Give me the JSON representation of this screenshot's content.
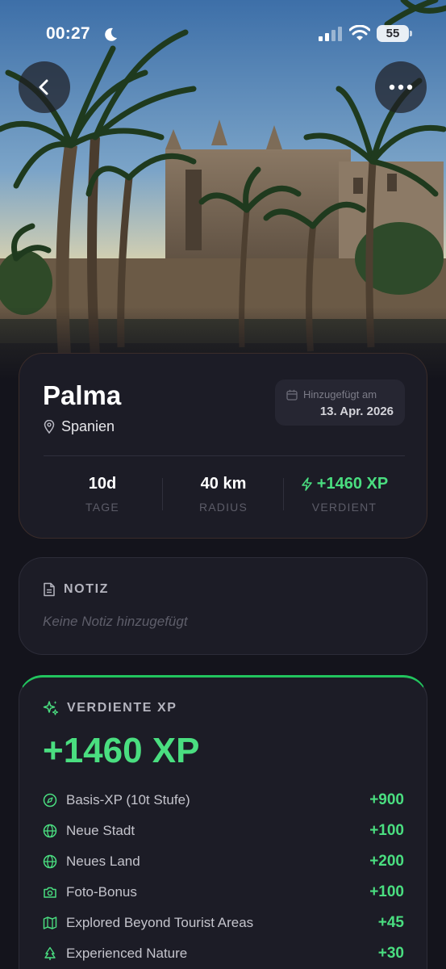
{
  "status_bar": {
    "time": "00:27",
    "battery": "55"
  },
  "place": {
    "city": "Palma",
    "country": "Spanien",
    "added_label": "Hinzugefügt am",
    "added_date": "13. Apr. 2026"
  },
  "stats": [
    {
      "value": "10d",
      "label": "TAGE"
    },
    {
      "value": "40 km",
      "label": "RADIUS"
    },
    {
      "value": "+1460 XP",
      "label": "VERDIENT"
    }
  ],
  "note": {
    "title": "NOTIZ",
    "placeholder": "Keine Notiz hinzugefügt"
  },
  "xp": {
    "title": "VERDIENTE XP",
    "total": "+1460 XP",
    "items": [
      {
        "icon": "compass-icon",
        "label": "Basis-XP (10t Stufe)",
        "value": "+900"
      },
      {
        "icon": "globe-icon",
        "label": "Neue Stadt",
        "value": "+100"
      },
      {
        "icon": "globe-icon",
        "label": "Neues Land",
        "value": "+200"
      },
      {
        "icon": "camera-icon",
        "label": "Foto-Bonus",
        "value": "+100"
      },
      {
        "icon": "map-icon",
        "label": "Explored Beyond Tourist Areas",
        "value": "+45"
      },
      {
        "icon": "tree-icon",
        "label": "Experienced Nature",
        "value": "+30"
      }
    ]
  },
  "colors": {
    "accent": "#4ade80",
    "background": "#14141c",
    "card": "#1c1c26"
  }
}
